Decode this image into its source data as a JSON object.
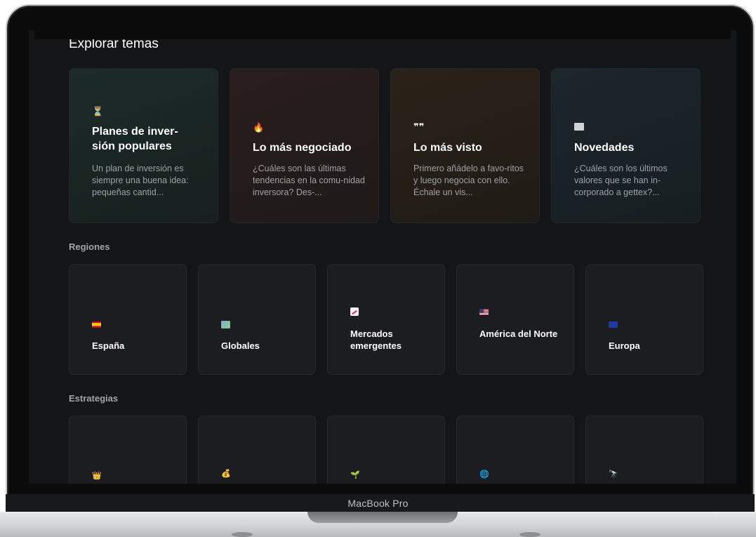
{
  "device": {
    "brand_label": "MacBook Pro"
  },
  "explore": {
    "title": "Explorar temas",
    "cards": [
      {
        "icon": "hourglass-icon",
        "title": "Planes de inver-\nsión populares",
        "description": "Un plan de inversión es siempre una buena idea: pequeñas cantid...",
        "color": "#1a2724"
      },
      {
        "icon": "fire-icon",
        "title": "Lo más negociado",
        "description": "¿Cuáles son las últimas tendencias en la comu-nidad inversora? Des-...",
        "color": "#261c1c"
      },
      {
        "icon": "quote-icon",
        "title": "Lo más visto",
        "description": "Primero añádelo a favo-ritos y luego negocia con ello. Échale un vis...",
        "color": "#262019"
      },
      {
        "icon": "newspaper-icon",
        "title": "Novedades",
        "description": "¿Cuáles son los últimos valores que se han in-corporado a gettex?...",
        "color": "#1b2328"
      }
    ]
  },
  "regions": {
    "title": "Regiones",
    "items": [
      {
        "icon": "spain-flag-icon",
        "label": "España"
      },
      {
        "icon": "world-map-icon",
        "label": "Globales"
      },
      {
        "icon": "chart-increasing-icon",
        "label": "Mercados emergentes"
      },
      {
        "icon": "usa-flag-icon",
        "label": "América del Norte"
      },
      {
        "icon": "eu-flag-icon",
        "label": "Europa"
      }
    ]
  },
  "strategies": {
    "title": "Estrategias",
    "items": [
      {
        "icon": "crown-icon"
      },
      {
        "icon": "money-bag-icon"
      },
      {
        "icon": "seedling-icon"
      },
      {
        "icon": "globe-icon"
      },
      {
        "icon": "telescope-icon"
      }
    ]
  }
}
